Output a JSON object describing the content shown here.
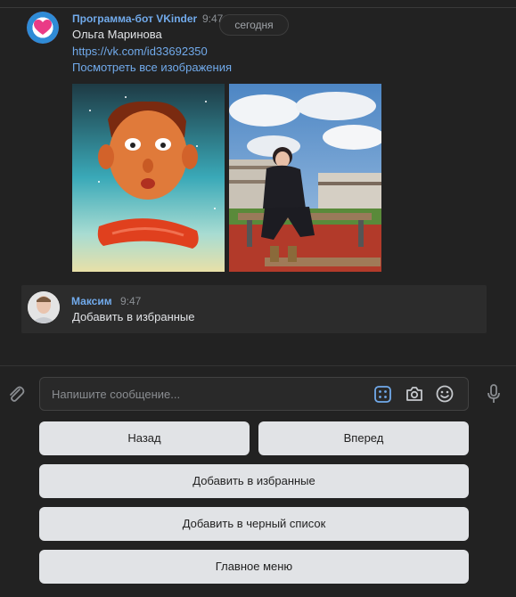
{
  "message1": {
    "sender": "Программа-бот VKinder",
    "time": "9:47",
    "date_separator": "сегодня",
    "name": "Ольга Маринова",
    "profile_link": "https://vk.com/id33692350",
    "view_all_link": "Посмотреть все изображения"
  },
  "message2": {
    "sender": "Максим",
    "time": "9:47",
    "text": "Добавить в избранные"
  },
  "composer": {
    "placeholder": "Напишите сообщение..."
  },
  "keyboard": {
    "back": "Назад",
    "forward": "Вперед",
    "add_favorite": "Добавить в избранные",
    "add_blacklist": "Добавить в черный список",
    "main_menu": "Главное меню"
  },
  "icons": [
    "heart-icon",
    "attach-icon",
    "bot-keyboard-icon",
    "camera-icon",
    "emoji-icon",
    "microphone-icon"
  ],
  "colors": {
    "link": "#71aaeb",
    "background": "#222222",
    "button": "#e1e3e6"
  }
}
